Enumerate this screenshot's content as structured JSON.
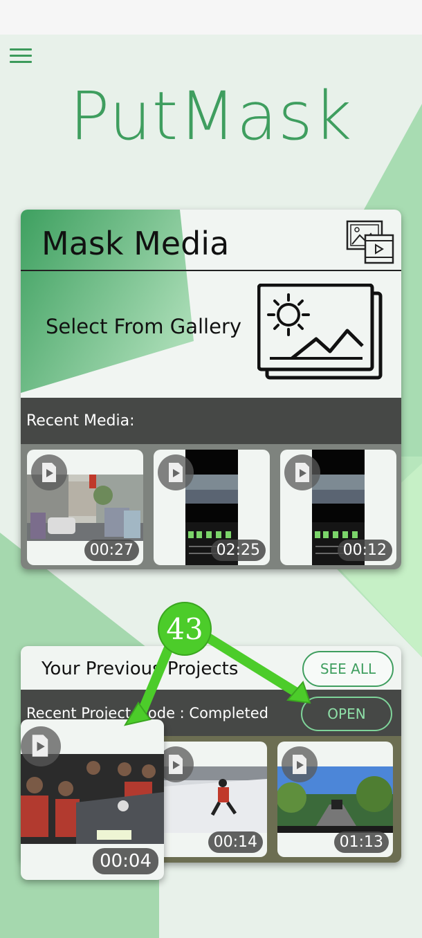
{
  "app": {
    "title": "PutMask"
  },
  "mask_media": {
    "title": "Mask Media",
    "gallery_label": "Select From Gallery",
    "recent_label": "Recent Media:",
    "recent_items": [
      {
        "duration": "00:27"
      },
      {
        "duration": "02:25"
      },
      {
        "duration": "00:12"
      }
    ]
  },
  "projects": {
    "title": "Your Previous Projects",
    "see_all": "SEE ALL",
    "recent_label": "Recent Project Mode : Completed",
    "open": "OPEN",
    "items": [
      {
        "duration": "00:04"
      },
      {
        "duration": "00:14"
      },
      {
        "duration": "01:13"
      }
    ]
  },
  "annotation": {
    "number": "43",
    "color": "#4ccc2a"
  },
  "colors": {
    "accent": "#3f9e5f",
    "bar": "#464846",
    "background": "#e8f1ea"
  },
  "icons": [
    "menu-icon",
    "media-icon",
    "gallery-icon",
    "play-icon"
  ]
}
